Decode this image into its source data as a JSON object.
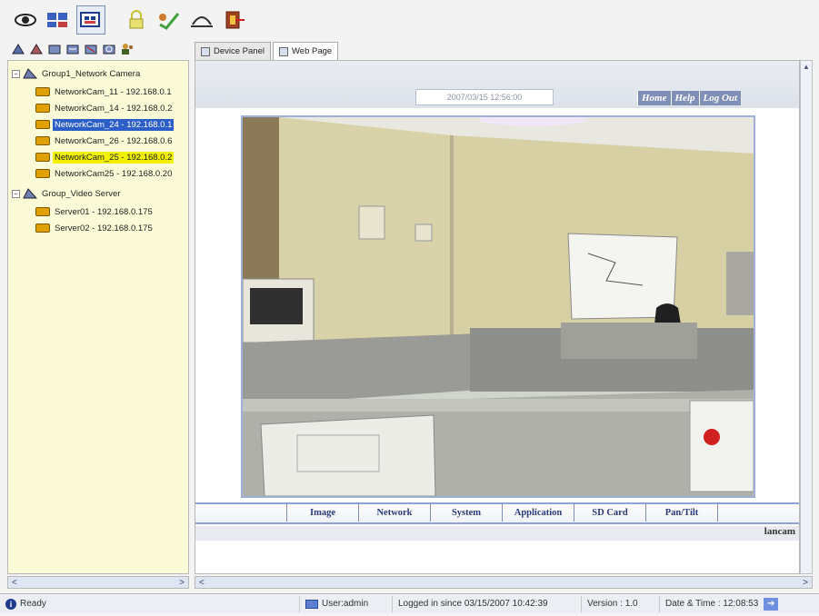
{
  "toolbar": {
    "icons": [
      "eye-icon",
      "view-grid-icon",
      "web-view-icon",
      "lock-icon",
      "checklist-icon",
      "disconnect-icon",
      "exit-icon"
    ]
  },
  "left_toolbar": {
    "icons": [
      "add-group-icon",
      "remove-group-icon",
      "add-device-icon",
      "edit-device-icon",
      "remove-device-icon",
      "search-device-icon",
      "users-icon"
    ]
  },
  "tree": {
    "groups": [
      {
        "label": "Group1_Network Camera",
        "items": [
          {
            "label": "NetworkCam_11 - 192.168.0.1"
          },
          {
            "label": "NetworkCam_14 - 192.168.0.2"
          },
          {
            "label": "NetworkCam_24 - 192.168.0.1"
          },
          {
            "label": "NetworkCam_26 - 192.168.0.6"
          },
          {
            "label": "NetworkCam_25 - 192.168.0.2"
          },
          {
            "label": "NetworkCam25 - 192.168.0.20"
          }
        ]
      },
      {
        "label": "Group_Video Server",
        "items": [
          {
            "label": "Server01 - 192.168.0.175"
          },
          {
            "label": "Server02 - 192.168.0.175"
          }
        ]
      }
    ]
  },
  "tabs": [
    {
      "label": "Device Panel"
    },
    {
      "label": "Web Page"
    }
  ],
  "webpage": {
    "datetime": "2007/03/15 12:56:00",
    "nav": [
      "Home",
      "Help",
      "Log Out"
    ],
    "bottom_tabs": [
      "Image",
      "Network",
      "System",
      "Application",
      "SD Card",
      "Pan/Tilt"
    ],
    "brand": "lancam"
  },
  "status": {
    "ready": "Ready",
    "user": "User:admin",
    "logged_in": "Logged in since 03/15/2007 10:42:39",
    "version": "Version : 1.0",
    "datetime": "Date & Time : 12:08:53"
  },
  "colors": {
    "tree_bg": "#fbfbd8",
    "selection": "#2b5fc7",
    "highlight": "#f0f000",
    "nav_link_bg": "#7f8fb6",
    "tab_border": "#8ea4d4"
  }
}
